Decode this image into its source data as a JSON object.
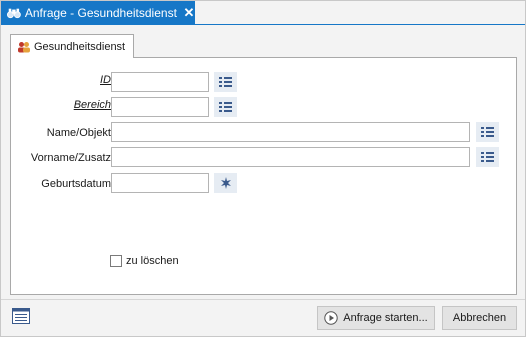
{
  "window": {
    "title": "Anfrage - Gesundheitsdienst",
    "close_symbol": "✕"
  },
  "tab": {
    "label": "Gesundheitsdienst",
    "icon": "people-icon"
  },
  "form": {
    "fields": [
      {
        "label": "ID",
        "value": "",
        "underlined": true,
        "lookup_icon": "list-lookup-icon"
      },
      {
        "label": "Bereich",
        "value": "",
        "underlined": true,
        "lookup_icon": "list-lookup-icon"
      },
      {
        "label": "Name/Objekt",
        "value": "",
        "underlined": false,
        "lookup_icon": "list-lookup-icon"
      },
      {
        "label": "Vorname/Zusatz",
        "value": "",
        "underlined": false,
        "lookup_icon": "list-lookup-icon"
      },
      {
        "label": "Geburtsdatum",
        "value": "",
        "underlined": false,
        "lookup_icon": "date-picker-icon"
      }
    ],
    "delete_checkbox": {
      "label": "zu löschen",
      "checked": false
    }
  },
  "footer": {
    "start_button": "Anfrage starten...",
    "cancel_button": "Abbrechen"
  },
  "colors": {
    "titlebar": "#1677c7",
    "button_bg": "#e6ecf3"
  }
}
